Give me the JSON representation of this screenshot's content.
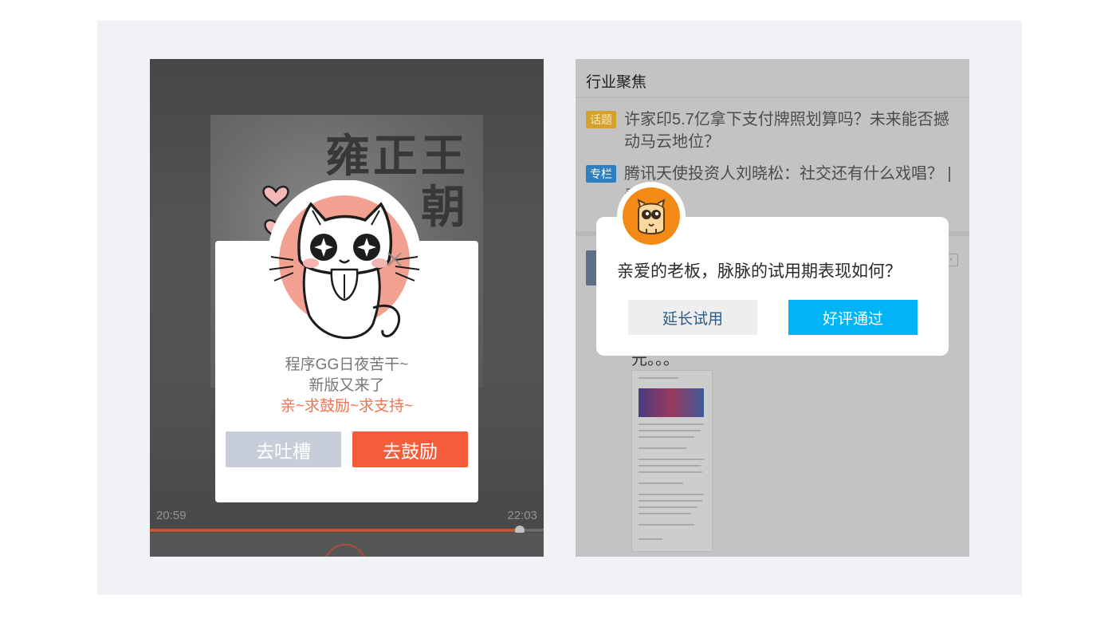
{
  "left_screen": {
    "poster_text": "雍正王朝",
    "elapsed_time": "20:59",
    "total_time": "22:03",
    "progress_fraction": 0.94,
    "dialog": {
      "line1": "程序GG日夜苦干~",
      "line2": "新版又来了",
      "line3": "亲~求鼓励~求支持~",
      "secondary_button": "去吐槽",
      "primary_button": "去鼓励"
    }
  },
  "right_screen": {
    "header_title": "行业聚焦",
    "news": [
      {
        "tag": "话题",
        "title": "许家印5.7亿拿下支付牌照划算吗？未来能否撼动马云地位？"
      },
      {
        "tag": "专栏",
        "title": "腾讯天使投资人刘晓松：社交还有什么戏唱？ | 青年"
      }
    ],
    "post_tail": "元。。。",
    "dialog": {
      "question": "亲爱的老板，脉脉的试用期表现如何？",
      "secondary_button": "延长试用",
      "primary_button": "好评通过"
    }
  },
  "colors": {
    "primary_orange": "#f45c3a",
    "muted_button": "#c7ced9",
    "primary_blue": "#00b4f5",
    "highlight_text": "#f0734f"
  },
  "icons": {
    "close": "close-icon",
    "cat": "cat-illustration-icon",
    "mascot": "mascot-face-icon",
    "heart": "heart-icon"
  }
}
